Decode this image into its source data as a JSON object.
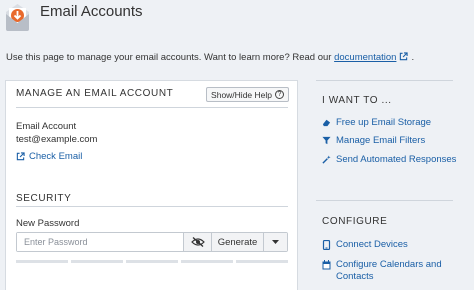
{
  "header": {
    "title": "Email Accounts"
  },
  "intro": {
    "text": "Use this page to manage your email accounts. Want to learn more? Read our",
    "link": "documentation",
    "period": "."
  },
  "manage": {
    "title": "MANAGE AN EMAIL ACCOUNT",
    "help_button": "Show/Hide Help",
    "account_label": "Email Account",
    "account_value": "test@example.com",
    "check_email": "Check Email"
  },
  "security": {
    "title": "SECURITY",
    "password_label": "New Password",
    "password_placeholder": "Enter Password",
    "generate": "Generate"
  },
  "sidebar": {
    "want_title": "I WANT TO ...",
    "want_items": [
      {
        "label": "Free up Email Storage",
        "icon": "eraser-icon"
      },
      {
        "label": "Manage Email Filters",
        "icon": "filter-icon"
      },
      {
        "label": "Send Automated Responses",
        "icon": "magic-wand-icon"
      }
    ],
    "configure_title": "CONFIGURE",
    "configure_items": [
      {
        "label": "Connect Devices",
        "icon": "mobile-icon"
      },
      {
        "label": "Configure Calendars and",
        "label2": "Contacts",
        "icon": "calendar-icon"
      }
    ]
  },
  "colors": {
    "link": "#1a5fa6",
    "logo": "#e8692c",
    "background": "#eef1f5"
  }
}
